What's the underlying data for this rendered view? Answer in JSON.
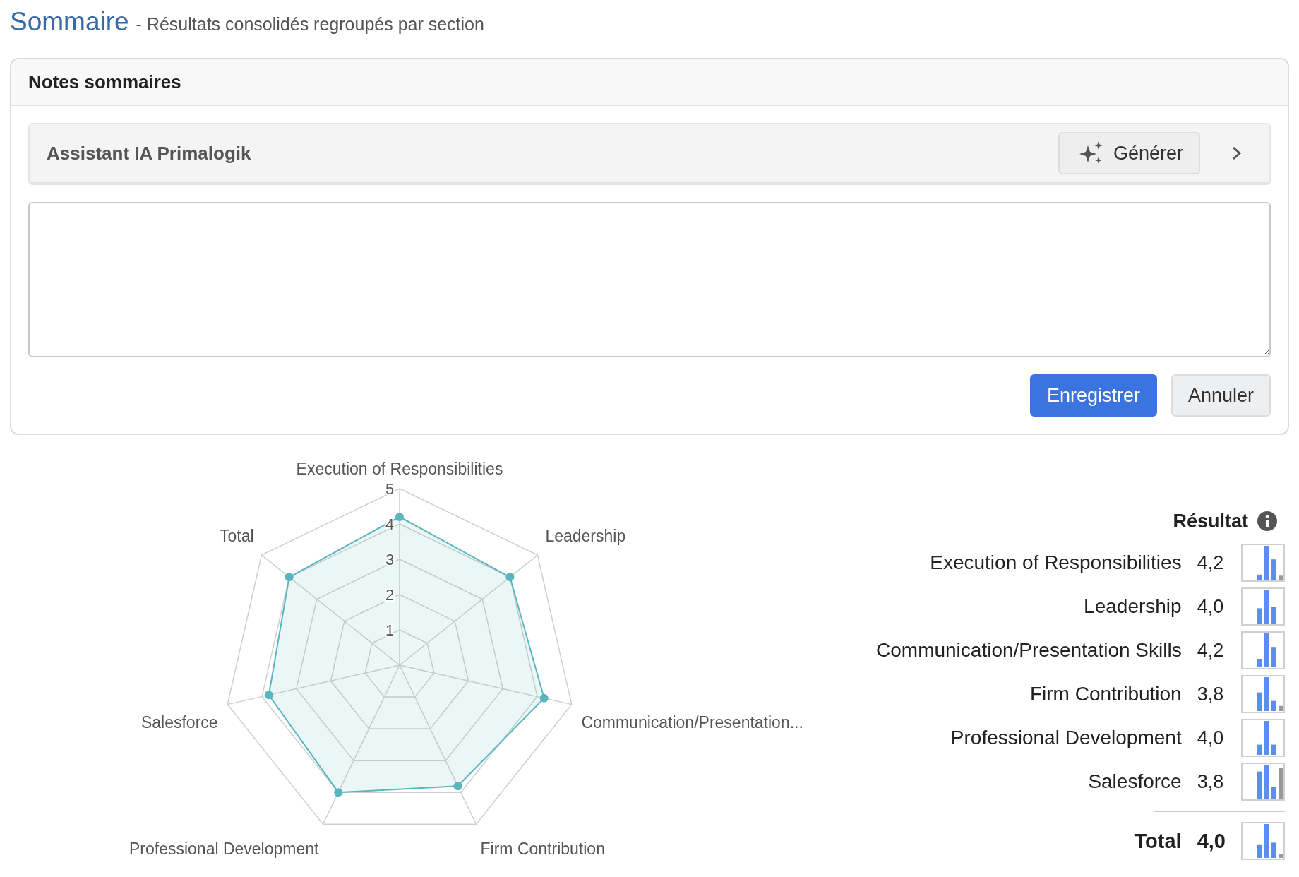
{
  "header": {
    "title": "Sommaire",
    "subtitle": "- Résultats consolidés regroupés par section"
  },
  "notes_card": {
    "title": "Notes sommaires",
    "assistant": {
      "title": "Assistant IA Primalogik",
      "generate_button": "Générer",
      "expanded": false
    },
    "buttons": [
      {
        "label": "Enregistrer",
        "kind": "primary"
      },
      {
        "label": "Annuler",
        "kind": "secondary"
      }
    ]
  },
  "radar": {
    "chart_data": {
      "type": "radar",
      "categories": [
        "Execution of Responsibilities",
        "Leadership",
        "Communication/Presentation...",
        "Firm Contribution",
        "Professional Development",
        "Salesforce",
        "Total"
      ],
      "series": [
        {
          "color": "#5bb5bf",
          "values": [
            4.2,
            4.0,
            4.2,
            3.8,
            4.0,
            3.8,
            4.0
          ]
        }
      ],
      "ylim": [
        0,
        5
      ],
      "yticks": [
        1,
        2,
        3,
        4,
        5
      ]
    }
  },
  "results": {
    "heading": "Résultat",
    "rows": [
      {
        "label": "Execution of Responsibilities",
        "value": "4,2"
      },
      {
        "label": "Leadership",
        "value": "4,0"
      },
      {
        "label": "Communication/Presentation Skills",
        "value": "4,2"
      },
      {
        "label": "Firm Contribution",
        "value": "3,8"
      },
      {
        "label": "Professional Development",
        "value": "4,0"
      },
      {
        "label": "Salesforce",
        "value": "3,8"
      }
    ],
    "total": {
      "label": "Total",
      "value": "4,0"
    }
  }
}
